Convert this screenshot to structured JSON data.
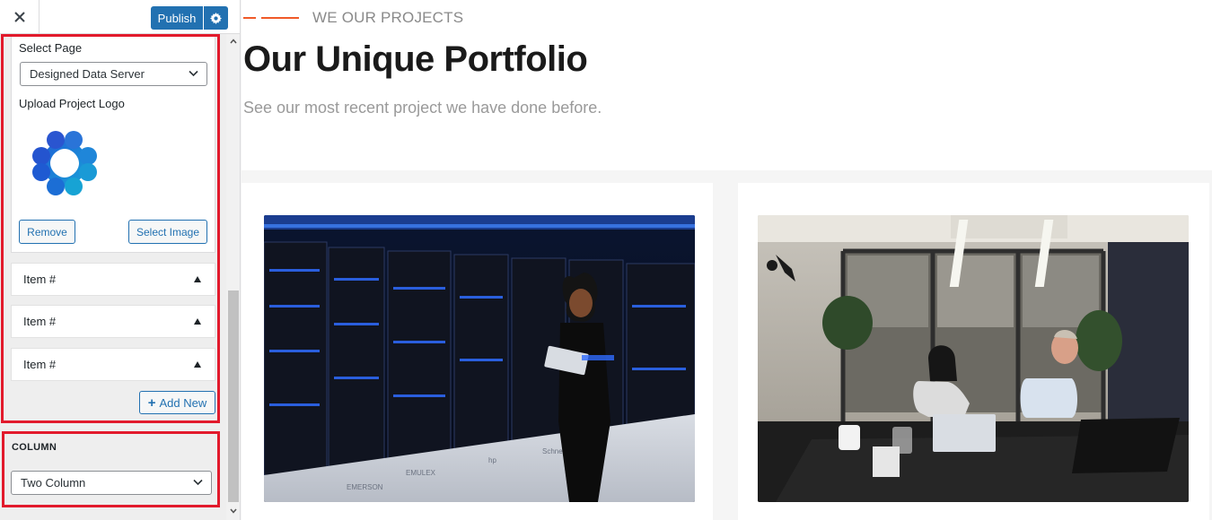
{
  "sidebar": {
    "close_icon": "close-icon",
    "publish_label": "Publish",
    "gear_icon": "gear-icon",
    "select_page_label": "Select Page",
    "select_page_value": "Designed Data Server",
    "upload_logo_label": "Upload Project Logo",
    "remove_label": "Remove",
    "select_image_label": "Select Image",
    "items": [
      {
        "label": "Item #"
      },
      {
        "label": "Item #"
      },
      {
        "label": "Item #"
      }
    ],
    "add_new_label": "Add New",
    "column_title": "COLUMN",
    "column_value": "Two Column",
    "highlight_color": "#e21a2c",
    "accent_color": "#2271b1"
  },
  "preview": {
    "eyebrow": "WE OUR PROJECTS",
    "heading": "Our Unique Portfolio",
    "subheading": "See our most recent project we have done before.",
    "accent_color": "#f05a28",
    "cards": [
      {
        "image": "data-server-room-photo"
      },
      {
        "image": "office-meeting-photo"
      }
    ]
  }
}
